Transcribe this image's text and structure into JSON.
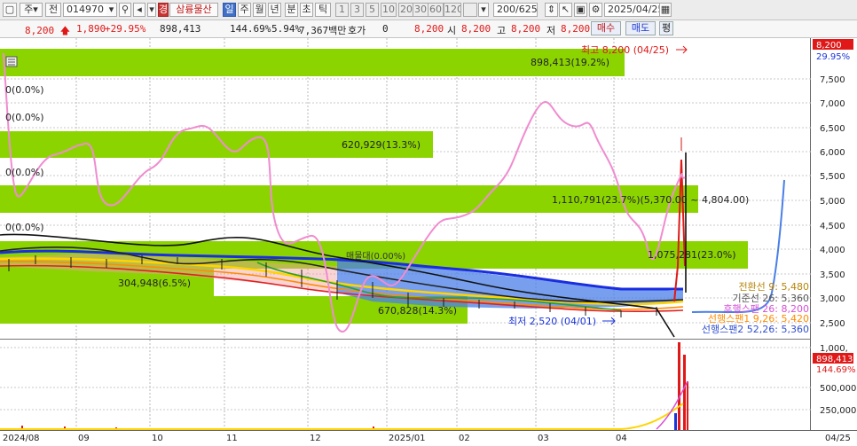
{
  "toolbar": {
    "market": "주",
    "market2": "전",
    "code": "014970",
    "stock_name": "삼륭물산",
    "period_tabs": [
      "일",
      "주",
      "월",
      "년",
      "분",
      "초",
      "틱"
    ],
    "interval_tabs": [
      "1",
      "3",
      "5",
      "10",
      "20",
      "30",
      "60",
      "120"
    ],
    "count": "200/625",
    "date": "2025/04/25"
  },
  "info": {
    "price": "8,200",
    "change": "1,890",
    "change_pct": "+29.95%",
    "volume": "898,413",
    "volume_ratio": "144.69%",
    "turnover": "5.94%",
    "amount": "7,367백만",
    "quote_label": "호가",
    "quote_value": "0",
    "quote_price": "8,200",
    "open_label": "시",
    "open": "8,200",
    "high_label": "고",
    "high": "8,200",
    "low_label": "저",
    "low": "8,200",
    "buy_label": "매수",
    "sell_label": "매도",
    "even_label": "평"
  },
  "chart": {
    "price_axis": [
      "7,500",
      "7,000",
      "6,500",
      "6,000",
      "5,500",
      "5,000",
      "4,500",
      "4,000",
      "3,500",
      "3,000",
      "2,500"
    ],
    "price_tag": "8,200",
    "pct_tag": "29.95%",
    "high_note": "최고 8,200 (04/25)",
    "low_note": "최저 2,520 (04/01)",
    "profile": [
      {
        "label": "898,413(19.2%)"
      },
      {
        "label": "620,929(13.3%)"
      },
      {
        "label": "1,110,791(23.7%)(5,370.00 ~ 4,804.00)"
      },
      {
        "label": "1,075,281(23.0%)"
      },
      {
        "label": "304,948(6.5%)"
      },
      {
        "label": "670,828(14.3%)"
      }
    ],
    "zero_labels": [
      "0(0.0%)",
      "0(0.0%)",
      "0(0.0%)",
      "0(0.0%)"
    ],
    "midband_label": "매물대(0.00%)",
    "ichimoku": [
      {
        "label": "전환선 9: 5,480",
        "color": "#b8860b"
      },
      {
        "label": "기준선 26: 5,360",
        "color": "#555555"
      },
      {
        "label": "후행스팬 26: 8,200",
        "color": "#d64fd6"
      },
      {
        "label": "선행스팬1 9,26: 5,420",
        "color": "#ff8c00"
      },
      {
        "label": "선행스팬2 52,26: 5,360",
        "color": "#3050d0"
      }
    ],
    "volume_axis": [
      "1,000,",
      "500,000",
      "250,000"
    ],
    "volume_tag": "898,413",
    "volume_pct_tag": "144.69%",
    "x_labels": [
      "2024/08",
      "09",
      "10",
      "11",
      "12",
      "2025/01",
      "02",
      "03",
      "04"
    ],
    "x_right_label": "04/25"
  }
}
